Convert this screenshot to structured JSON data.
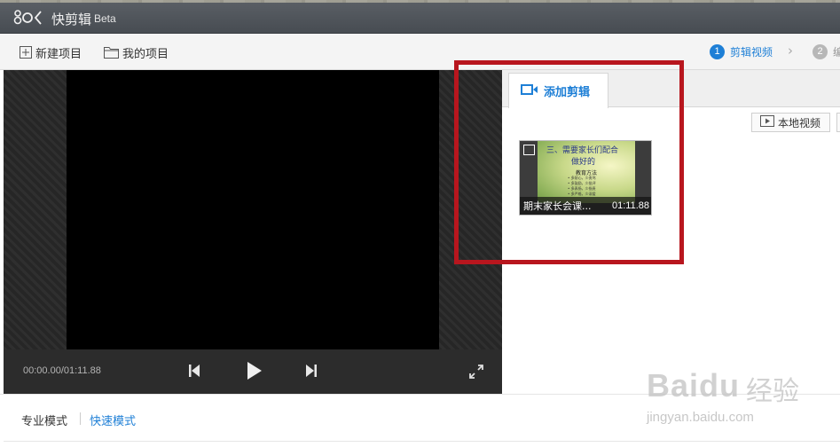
{
  "app": {
    "title": "快剪辑",
    "badge": "Beta"
  },
  "toolbar": {
    "new_project": "新建项目",
    "my_projects": "我的项目"
  },
  "steps": [
    {
      "num": "1",
      "label": "剪辑视频",
      "active": true
    },
    {
      "num": "2",
      "label": "编",
      "active": false
    }
  ],
  "player": {
    "time_display": "00:00.00/01:11.88"
  },
  "panel": {
    "tab_label": "添加剪辑",
    "local_video_button": "本地视频",
    "clips": [
      {
        "name": "期末家长会课...",
        "duration": "01:11.88",
        "slide_line1": "三、需要家长们配合",
        "slide_line2": "做好的",
        "slide_line3": "教育方法",
        "slide_bullets": [
          "• 多耐心，少责骂",
          "• 多鼓励，少批评",
          "• 多表扬，少指责",
          "• 多严格，少溺爱"
        ]
      }
    ]
  },
  "bottom": {
    "mode_pro": "专业模式",
    "mode_quick": "快速模式"
  },
  "watermark": {
    "brand": "Baidu",
    "brand_cn": "经验",
    "url": "jingyan.baidu.com"
  },
  "colors": {
    "accent": "#1e7fd6",
    "highlight_box": "#b8161e",
    "title_bar": "#4f545a"
  }
}
